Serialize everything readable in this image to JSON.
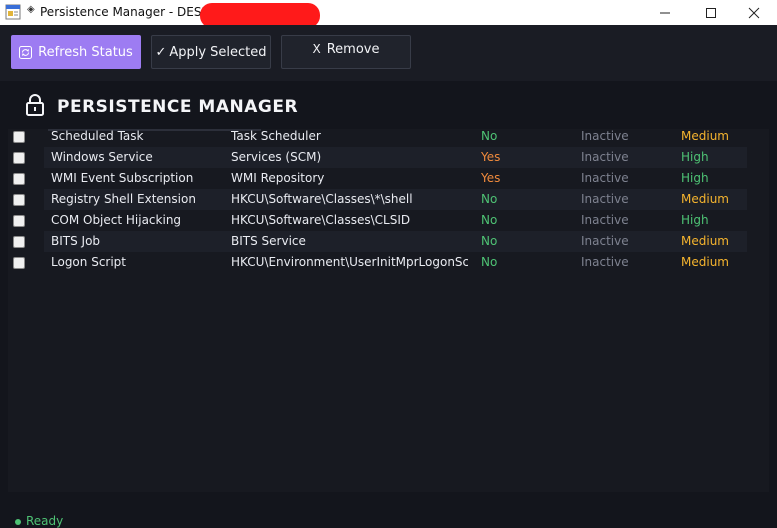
{
  "window": {
    "title": "Persistence Manager - DESKTO",
    "title_glyph": "◈"
  },
  "toolbar": {
    "refresh_label": "Refresh Status",
    "apply_label": "Apply Selected",
    "apply_glyph": "✓",
    "remove_label": "Remove",
    "remove_glyph": "X"
  },
  "header": {
    "title": "PERSISTENCE MANAGER",
    "icon": "lock-icon"
  },
  "colors": {
    "accent": "#9d7cf2",
    "yes": "#f08a3c",
    "no": "#4ec274",
    "high": "#4ec274",
    "medium": "#f5b42e",
    "inactive": "#7e8290",
    "ready": "#4ec274"
  },
  "rows": [
    {
      "name": "Scheduled Task",
      "location": "Task Scheduler",
      "installed": "No",
      "status": "Inactive",
      "risk": "Medium"
    },
    {
      "name": "Windows Service",
      "location": "Services (SCM)",
      "installed": "Yes",
      "status": "Inactive",
      "risk": "High"
    },
    {
      "name": "WMI Event Subscription",
      "location": "WMI Repository",
      "installed": "Yes",
      "status": "Inactive",
      "risk": "High"
    },
    {
      "name": "Registry Shell Extension",
      "location": "HKCU\\Software\\Classes\\*\\shell",
      "installed": "No",
      "status": "Inactive",
      "risk": "Medium"
    },
    {
      "name": "COM Object Hijacking",
      "location": "HKCU\\Software\\Classes\\CLSID",
      "installed": "No",
      "status": "Inactive",
      "risk": "High"
    },
    {
      "name": "BITS Job",
      "location": "BITS Service",
      "installed": "No",
      "status": "Inactive",
      "risk": "Medium"
    },
    {
      "name": "Logon Script",
      "location": "HKCU\\Environment\\UserInitMprLogonScript",
      "installed": "No",
      "status": "Inactive",
      "risk": "Medium"
    }
  ],
  "status_bar": {
    "text": "Ready"
  }
}
